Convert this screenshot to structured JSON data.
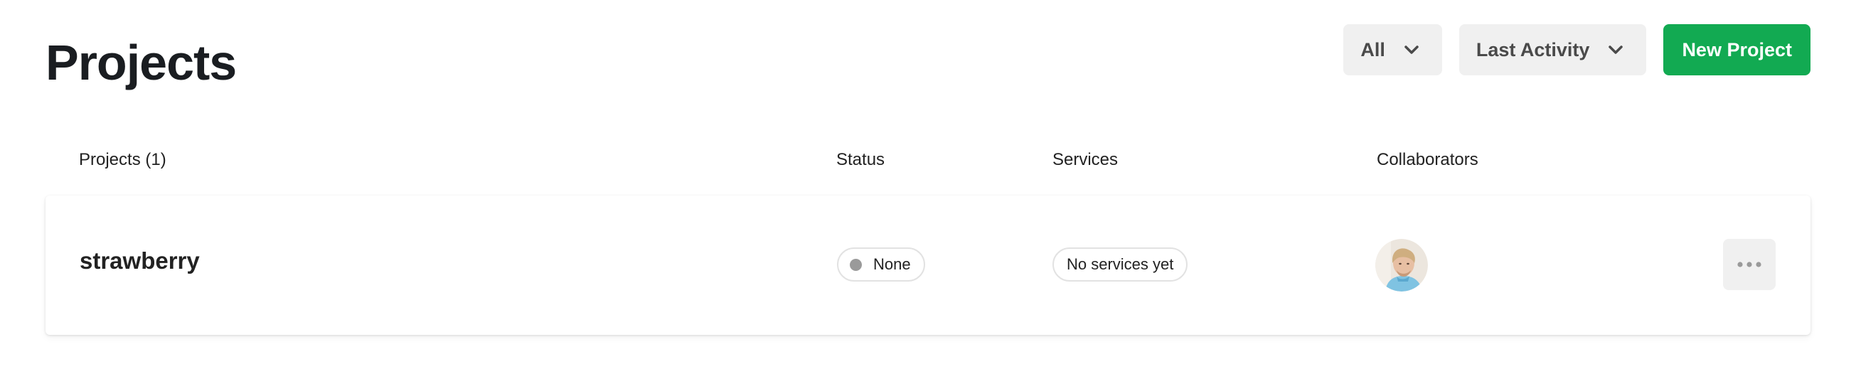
{
  "header": {
    "title": "Projects"
  },
  "toolbar": {
    "filter_label": "All",
    "sort_label": "Last Activity",
    "new_project_label": "New Project",
    "accent_color": "#12aa52"
  },
  "table": {
    "columns": {
      "projects": "Projects (1)",
      "status": "Status",
      "services": "Services",
      "collaborators": "Collaborators"
    },
    "rows": [
      {
        "name": "strawberry",
        "status": "None",
        "status_color": "#9a9a9a",
        "services": "No services yet",
        "collaborator_avatar": "user-avatar",
        "more_icon": "ellipsis-icon"
      }
    ]
  }
}
